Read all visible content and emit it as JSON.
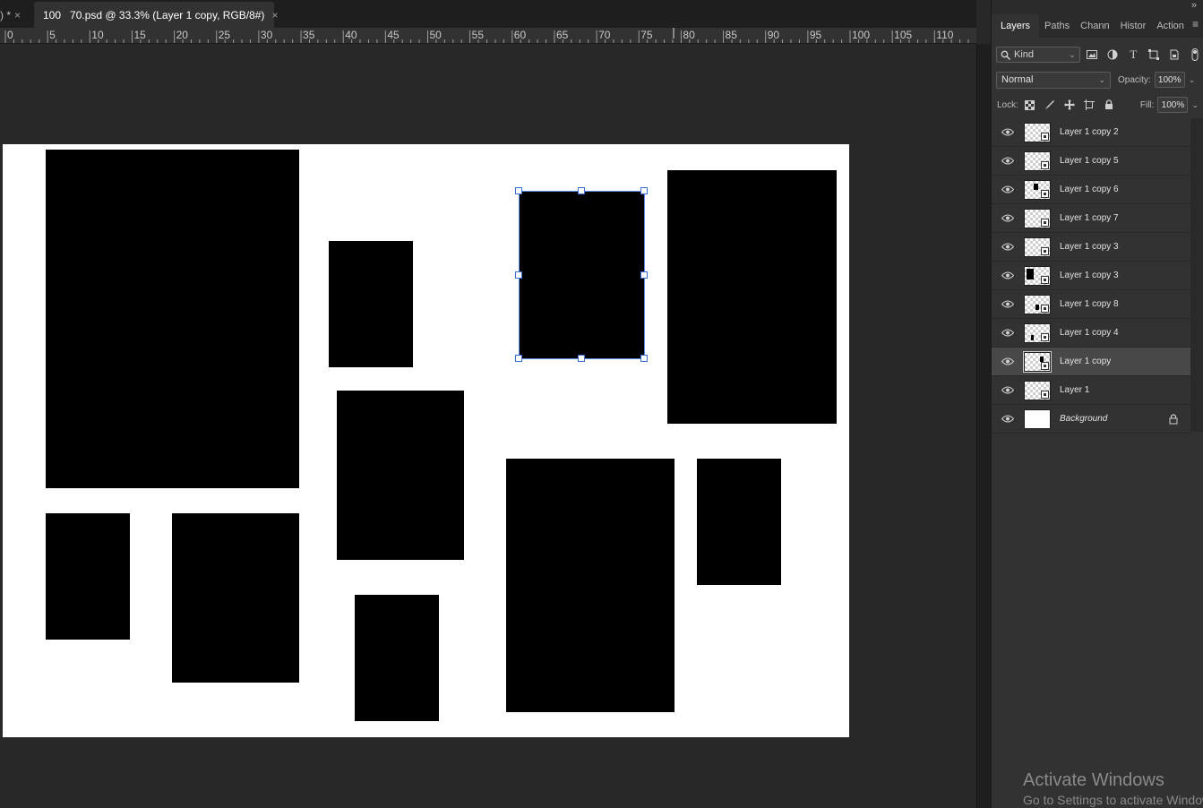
{
  "tabs": {
    "previous_tab_label": ") *",
    "active_tab_label": "100   70.psd @ 33.3% (Layer 1 copy, RGB/8#)",
    "close_glyph": "×"
  },
  "ruler": {
    "labels": [
      "0",
      "5",
      "10",
      "15",
      "20",
      "25",
      "30",
      "35",
      "40",
      "45",
      "50",
      "55",
      "60",
      "65",
      "70",
      "75",
      "80",
      "85",
      "90",
      "95",
      "100",
      "105",
      "110"
    ]
  },
  "panel": {
    "tabs": [
      "Layers",
      "Paths",
      "Chann",
      "Histor",
      "Action"
    ],
    "active_tab": "Layers",
    "filter": {
      "kind_label": "Kind"
    },
    "blend_mode": "Normal",
    "opacity_label": "Opacity:",
    "opacity_value": "100%",
    "lock_label": "Lock:",
    "fill_label": "Fill:",
    "fill_value": "100%",
    "layers": [
      {
        "name": "Layer 1 copy 2",
        "visible": true,
        "selected": false,
        "locked": false
      },
      {
        "name": "Layer 1 copy 5",
        "visible": true,
        "selected": false,
        "locked": false
      },
      {
        "name": "Layer 1 copy 6",
        "visible": true,
        "selected": false,
        "locked": false
      },
      {
        "name": "Layer 1 copy 7",
        "visible": true,
        "selected": false,
        "locked": false
      },
      {
        "name": "Layer 1 copy 3",
        "visible": true,
        "selected": false,
        "locked": false
      },
      {
        "name": "Layer 1 copy 3",
        "visible": true,
        "selected": false,
        "locked": false
      },
      {
        "name": "Layer 1 copy 8",
        "visible": true,
        "selected": false,
        "locked": false
      },
      {
        "name": "Layer 1 copy 4",
        "visible": true,
        "selected": false,
        "locked": false
      },
      {
        "name": "Layer 1 copy",
        "visible": true,
        "selected": true,
        "locked": false
      },
      {
        "name": "Layer 1",
        "visible": true,
        "selected": false,
        "locked": false
      },
      {
        "name": "Background",
        "visible": true,
        "selected": false,
        "locked": true
      }
    ]
  },
  "watermark": {
    "title": "Activate Windows",
    "subtitle": "Go to Settings to activate Windows."
  },
  "colors": {
    "canvas": "#ffffff",
    "shapes": "#000000",
    "selection": "#5c8ce6"
  }
}
